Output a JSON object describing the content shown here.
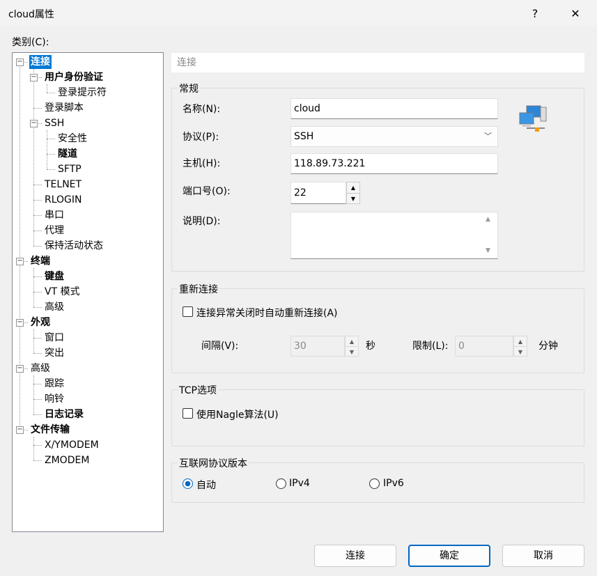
{
  "window": {
    "title": "cloud属性",
    "help": "?",
    "close": "✕"
  },
  "category_label": "类别(C):",
  "tree": [
    {
      "label": "连接",
      "level": 0,
      "bold": true,
      "selected": true,
      "expander": true
    },
    {
      "label": "用户身份验证",
      "level": 1,
      "bold": true,
      "expander": true
    },
    {
      "label": "登录提示符",
      "level": 2
    },
    {
      "label": "登录脚本",
      "level": 1
    },
    {
      "label": "SSH",
      "level": 1,
      "expander": true
    },
    {
      "label": "安全性",
      "level": 2
    },
    {
      "label": "隧道",
      "level": 2,
      "bold": true
    },
    {
      "label": "SFTP",
      "level": 2
    },
    {
      "label": "TELNET",
      "level": 1
    },
    {
      "label": "RLOGIN",
      "level": 1
    },
    {
      "label": "串口",
      "level": 1
    },
    {
      "label": "代理",
      "level": 1
    },
    {
      "label": "保持活动状态",
      "level": 1
    },
    {
      "label": "终端",
      "level": 0,
      "bold": true,
      "expander": true
    },
    {
      "label": "键盘",
      "level": 1,
      "bold": true
    },
    {
      "label": "VT 模式",
      "level": 1
    },
    {
      "label": "高级",
      "level": 1
    },
    {
      "label": "外观",
      "level": 0,
      "bold": true,
      "expander": true
    },
    {
      "label": "窗口",
      "level": 1
    },
    {
      "label": "突出",
      "level": 1
    },
    {
      "label": "高级",
      "level": 0,
      "expander": true
    },
    {
      "label": "跟踪",
      "level": 1
    },
    {
      "label": "响铃",
      "level": 1
    },
    {
      "label": "日志记录",
      "level": 1,
      "bold": true
    },
    {
      "label": "文件传输",
      "level": 0,
      "bold": true,
      "expander": true
    },
    {
      "label": "X/YMODEM",
      "level": 1
    },
    {
      "label": "ZMODEM",
      "level": 1
    }
  ],
  "panel": {
    "header": "连接",
    "general": {
      "title": "常规",
      "name_label": "名称(N):",
      "name_value": "cloud",
      "protocol_label": "协议(P):",
      "protocol_value": "SSH",
      "host_label": "主机(H):",
      "host_value": "118.89.73.221",
      "port_label": "端口号(O):",
      "port_value": "22",
      "desc_label": "说明(D):",
      "desc_value": ""
    },
    "reconnect": {
      "title": "重新连接",
      "auto_label": "连接异常关闭时自动重新连接(A)",
      "auto_checked": false,
      "interval_label": "间隔(V):",
      "interval_value": "30",
      "interval_unit": "秒",
      "limit_label": "限制(L):",
      "limit_value": "0",
      "limit_unit": "分钟"
    },
    "tcp": {
      "title": "TCP选项",
      "nagle_label": "使用Nagle算法(U)",
      "nagle_checked": false
    },
    "ip": {
      "title": "互联网协议版本",
      "options": [
        "自动",
        "IPv4",
        "IPv6"
      ],
      "selected": "自动"
    }
  },
  "buttons": {
    "connect": "连接",
    "ok": "确定",
    "cancel": "取消"
  }
}
